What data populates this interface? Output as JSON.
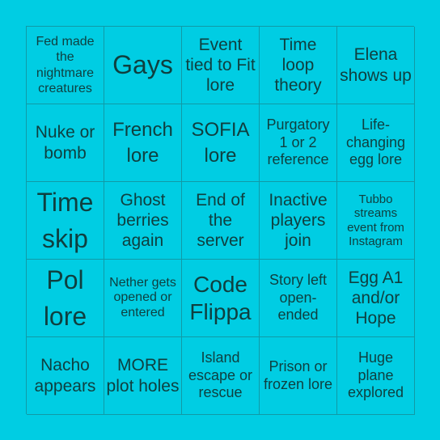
{
  "card": {
    "cells": [
      "Fed made the nightmare creatures",
      "Gays",
      "Event tied to Fit lore",
      "Time loop theory",
      "Elena shows up",
      "Nuke or bomb",
      "French lore",
      "SOFIA lore",
      "Purgatory 1 or 2 reference",
      "Life-changing egg lore",
      "Time skip",
      "Ghost berries again",
      "End of the server",
      "Inactive players join",
      "Tubbo streams event from Instagram",
      "Pol lore",
      "Nether gets opened or entered",
      "Code Flippa",
      "Story left open-ended",
      "Egg A1 and/or Hope",
      "Nacho appears",
      "MORE plot holes",
      "Island escape or rescue",
      "Prison or frozen lore",
      "Huge plane explored"
    ]
  },
  "colors": {
    "background": "#00cde3",
    "border": "#119aa6",
    "text": "#0f3f3f"
  }
}
